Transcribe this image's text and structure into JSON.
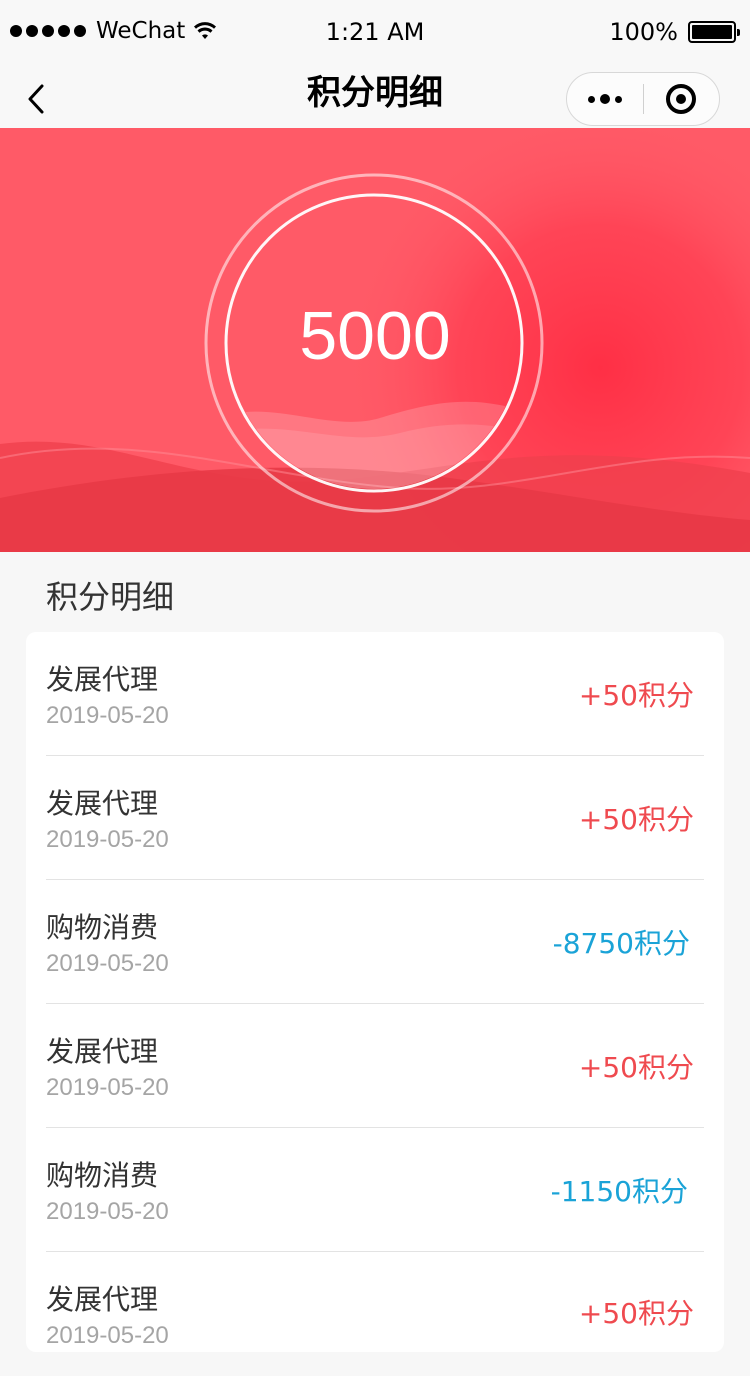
{
  "status_bar": {
    "carrier": "WeChat",
    "time": "1:21 AM",
    "battery": "100%"
  },
  "nav": {
    "title": "积分明细"
  },
  "hero": {
    "points": "5000"
  },
  "section": {
    "title": "积分明细"
  },
  "records": [
    {
      "name": "发展代理",
      "date": "2019-05-20",
      "amount": "+50积分",
      "type": "positive"
    },
    {
      "name": "发展代理",
      "date": "2019-05-20",
      "amount": "+50积分",
      "type": "positive"
    },
    {
      "name": "购物消费",
      "date": "2019-05-20",
      "amount": "-8750积分",
      "type": "negative"
    },
    {
      "name": "发展代理",
      "date": "2019-05-20",
      "amount": "+50积分",
      "type": "positive"
    },
    {
      "name": "购物消费",
      "date": "2019-05-20",
      "amount": "-1150积分",
      "type": "negative"
    },
    {
      "name": "发展代理",
      "date": "2019-05-20",
      "amount": "+50积分",
      "type": "positive"
    }
  ],
  "colors": {
    "hero_red": "#ff5a67",
    "positive": "#ef4a4f",
    "negative": "#1aa3d7"
  }
}
